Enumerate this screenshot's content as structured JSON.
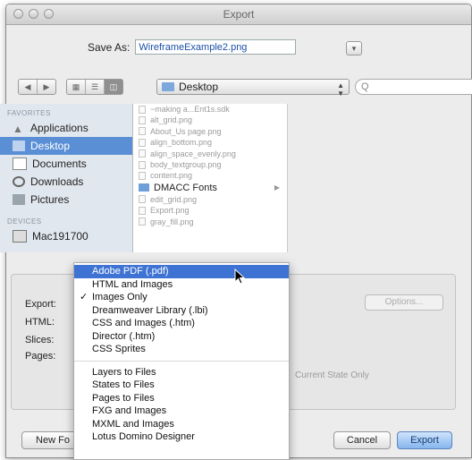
{
  "window": {
    "title": "Export"
  },
  "save_as": {
    "label": "Save As:",
    "value": "WireframeExample2.png"
  },
  "toolbar": {
    "location": "Desktop",
    "search_placeholder": "Q"
  },
  "sidebar": {
    "favorites_header": "FAVORITES",
    "favorites": [
      "Applications",
      "Desktop",
      "Documents",
      "Downloads",
      "Pictures"
    ],
    "selected": "Desktop",
    "devices_header": "DEVICES",
    "devices": [
      "Mac191700"
    ]
  },
  "files": [
    "~making a...Ent1s.sdk",
    "alt_grid.png",
    "About_Us page.png",
    "align_bottom.png",
    "align_space_evenly.png",
    "body_textgroup.png",
    "content.png",
    "DMACC Fonts",
    "edit_grid.png",
    "Export.png",
    "gray_fill.png"
  ],
  "lower": {
    "export_label": "Export:",
    "html_label": "HTML:",
    "slices_label": "Slices:",
    "pages_label": "Pages:",
    "options_button": "Options...",
    "current_state_only": "Current State Only"
  },
  "buttons": {
    "new_folder": "New Fo",
    "cancel": "Cancel",
    "export": "Export"
  },
  "menu": {
    "group1": [
      "Adobe PDF (.pdf)",
      "HTML and Images",
      "Images Only",
      "Dreamweaver Library (.lbi)",
      "CSS and Images (.htm)",
      "Director (.htm)",
      "CSS Sprites"
    ],
    "group2": [
      "Layers to Files",
      "States to Files",
      "Pages to Files",
      "FXG and Images",
      "MXML and Images",
      "Lotus Domino Designer"
    ],
    "highlighted": "Adobe PDF (.pdf)",
    "checked": "Images Only",
    "highlight_color": "#3e73d3"
  }
}
